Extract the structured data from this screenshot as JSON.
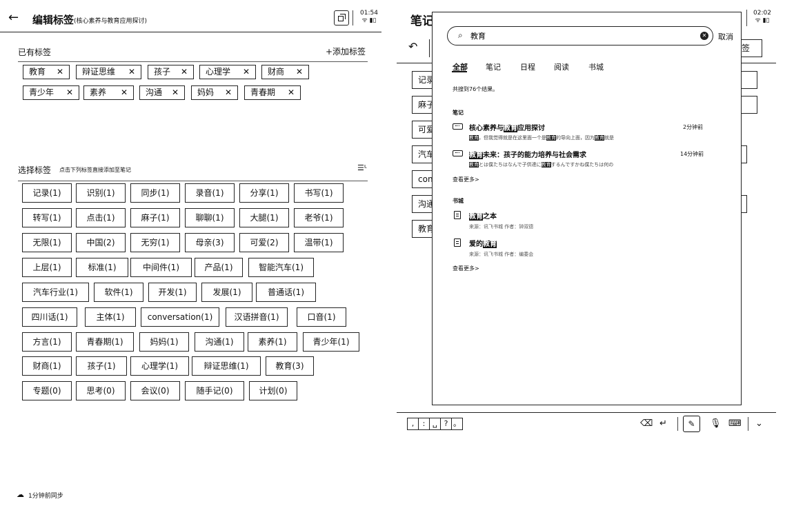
{
  "left_panel": {
    "back_icon": "arrow-left-icon",
    "title": "编辑标签",
    "subtitle": "(核心素养与教育应用探讨)",
    "status": {
      "time": "01:54",
      "icons": "wifi-battery"
    },
    "existing": {
      "label": "已有标签",
      "add_button": "+添加标签",
      "tags": [
        "教育",
        "辩证思维",
        "孩子",
        "心理学",
        "财商",
        "青少年",
        "素养",
        "沟通",
        "妈妈",
        "青春期"
      ],
      "remove_symbol": "✕"
    },
    "select": {
      "label": "选择标签",
      "hint": "点击下列标签直接添加至笔记",
      "sort_icon": "sort-icon",
      "tags": [
        [
          "记录(1)",
          "识别(1)",
          "同步(1)",
          "录音(1)",
          "分享(1)",
          "书写(1)"
        ],
        [
          "转写(1)",
          "点击(1)",
          "麻子(1)",
          "聊聊(1)",
          "大腿(1)",
          "老爷(1)"
        ],
        [
          "无限(1)",
          "中国(2)",
          "无穷(1)",
          "母亲(3)",
          "可爱(2)",
          "温带(1)"
        ],
        [
          "上层(1)",
          "标准(1)",
          "中间件(1)",
          "产品(1)",
          "智能汽车(1)"
        ],
        [
          "汽车行业(1)",
          "软件(1)",
          "开发(1)",
          "发展(1)",
          "普通话(1)"
        ],
        [
          "四川话(1)",
          "主体(1)",
          "conversation(1)",
          "汉语拼音(1)",
          "口音(1)"
        ],
        [
          "方言(1)",
          "青春期(1)",
          "妈妈(1)",
          "沟通(1)",
          "素养(1)",
          "青少年(1)"
        ],
        [
          "财商(1)",
          "孩子(1)",
          "心理学(1)",
          "辩证思维(1)",
          "教育(3)"
        ],
        [
          "专题(0)",
          "思考(0)",
          "会议(0)",
          "随手记(0)",
          "计划(0)"
        ]
      ]
    },
    "sync_text": "1分钟前同步"
  },
  "right_panel": {
    "bg_title": "笔记",
    "status": {
      "time": "02:02"
    },
    "bg_right_button": "签",
    "bg_tags": [
      "记录",
      "麻子",
      "可爱",
      "汽车",
      "con",
      "沟通",
      "教育"
    ],
    "search": {
      "query": "教育",
      "cancel": "取消",
      "tabs": [
        "全部",
        "笔记",
        "日程",
        "阅读",
        "书城"
      ],
      "active_tab": "全部",
      "result_count": "共搜到76个结果。",
      "notes_section": "笔记",
      "notes": [
        {
          "title_pre": "核心素养与",
          "title_hl": "教育",
          "title_post": "应用探讨",
          "time": "2分钟前",
          "snippet_hl1": "教育",
          "snippet_mid": "，但我觉得就是在这里面一个是",
          "snippet_hl2": "教育",
          "snippet_mid2": "的导向上面，因为",
          "snippet_hl3": "教育",
          "snippet_end": "就是"
        },
        {
          "title_pre": "",
          "title_hl": "教育",
          "title_post": "未来：孩子的能力培养与社会需求",
          "time": "14分钟前",
          "snippet_hl1": "教育",
          "snippet_mid": "とは僕たちはなんで子供達に",
          "snippet_hl2": "教育",
          "snippet_mid2": "するんですかね僕たちは何の",
          "snippet_hl3": "",
          "snippet_end": ""
        }
      ],
      "notes_more": "查看更多>",
      "books_section": "书城",
      "books": [
        {
          "title_pre": "",
          "title_hl": "教育",
          "title_post": "之本",
          "source": "来源：讯飞书城  作者：钟双德"
        },
        {
          "title_pre": "爱的",
          "title_hl": "教育",
          "title_post": "",
          "source": "来源：讯飞书城  作者：编委会"
        }
      ],
      "books_more": "查看更多>"
    },
    "keyboard": {
      "punctuation": [
        ",",
        ":",
        "␣",
        "?",
        "。"
      ],
      "tools": [
        "backspace-icon",
        "enter-icon",
        "pen-icon",
        "mic-icon",
        "keyboard-icon",
        "collapse-icon"
      ]
    }
  }
}
